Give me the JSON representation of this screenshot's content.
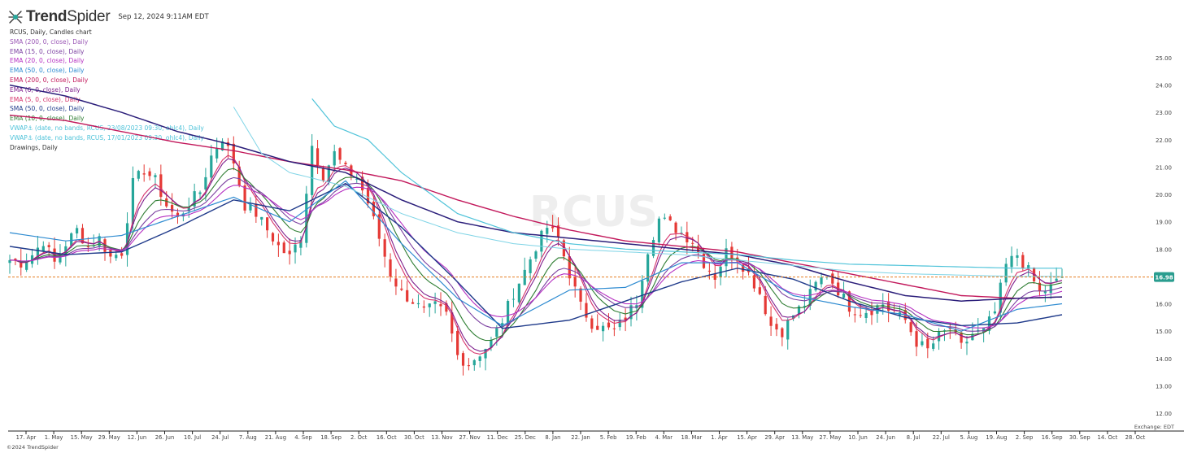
{
  "header": {
    "brand_name": "TrendSpider",
    "datetime": "Sep 12, 2024 9:11AM EDT"
  },
  "chart_info": {
    "title": "RCUS, Daily, Candles chart",
    "indicators": [
      {
        "label": "SMA (200, 0, close), Daily",
        "color": "#9b59b6"
      },
      {
        "label": "EMA (15, 0, close), Daily",
        "color": "#7b3fa0"
      },
      {
        "label": "EMA (20, 0, close), Daily",
        "color": "#b52fc1"
      },
      {
        "label": "EMA (50, 0, close), Daily",
        "color": "#2e8bd1"
      },
      {
        "label": "EMA (200, 0, close), Daily",
        "color": "#c2185b"
      },
      {
        "label": "EMA (6, 0, close), Daily",
        "color": "#7e1e8c"
      },
      {
        "label": "EMA (5, 0, close), Daily",
        "color": "#d6336c"
      },
      {
        "label": "SMA (50, 0, close), Daily",
        "color": "#1f3a8a"
      },
      {
        "label": "EMA (10, 0, close), Daily",
        "color": "#2e7d32"
      },
      {
        "label": "VWAP⚓ (date, no bands, RCUS, 23/08/2023 09:30, ohlc4), Daily",
        "color": "#4fc3d9"
      },
      {
        "label": "VWAP⚓ (date, no bands, RCUS, 17/01/2023 09:30, ohlc4), Daily",
        "color": "#4fc3d9"
      },
      {
        "label": "Drawings, Daily",
        "color": "#333333"
      }
    ]
  },
  "footer": {
    "copyright": "©2024 TrendSpider",
    "exchange": "Exchange: EDT"
  },
  "chart_data": {
    "type": "candlestick",
    "symbol": "RCUS",
    "watermark": "RCUS",
    "timeframe": "Daily",
    "ylim": [
      12.0,
      25.0
    ],
    "y_ticks": [
      12.0,
      13.0,
      14.0,
      15.0,
      16.0,
      17.0,
      18.0,
      19.0,
      20.0,
      21.0,
      22.0,
      23.0,
      24.0,
      25.0
    ],
    "x_ticks": [
      "17. Apr",
      "1. May",
      "15. May",
      "29. May",
      "12. Jun",
      "26. Jun",
      "10. Jul",
      "24. Jul",
      "7. Aug",
      "21. Aug",
      "4. Sep",
      "18. Sep",
      "2. Oct",
      "16. Oct",
      "30. Oct",
      "13. Nov",
      "27. Nov",
      "11. Dec",
      "25. Dec",
      "8. Jan",
      "22. Jan",
      "5. Feb",
      "19. Feb",
      "4. Mar",
      "18. Mar",
      "1. Apr",
      "15. Apr",
      "29. Apr",
      "13. May",
      "27. May",
      "10. Jun",
      "24. Jun",
      "8. Jul",
      "22. Jul",
      "5. Aug",
      "19. Aug",
      "2. Sep",
      "16. Sep",
      "30. Sep",
      "14. Oct",
      "28. Oct"
    ],
    "current_price": 16.98,
    "current_price_label": "16.98",
    "price_line_color": "#e67e22",
    "price_label_color": "#2a9d8f",
    "up_color": "#26a69a",
    "down_color": "#e53935",
    "close_path": [
      [
        0,
        17.6
      ],
      [
        2,
        17.5
      ],
      [
        4,
        17.8
      ],
      [
        6,
        18.3
      ],
      [
        8,
        17.5
      ],
      [
        10,
        18.2
      ],
      [
        12,
        18.7
      ],
      [
        14,
        18.1
      ],
      [
        16,
        18.4
      ],
      [
        18,
        17.7
      ],
      [
        20,
        17.9
      ],
      [
        22,
        20.4
      ],
      [
        24,
        20.9
      ],
      [
        26,
        20.5
      ],
      [
        28,
        19.6
      ],
      [
        30,
        19.1
      ],
      [
        32,
        19.7
      ],
      [
        34,
        20.1
      ],
      [
        36,
        21.4
      ],
      [
        38,
        22.1
      ],
      [
        40,
        21.2
      ],
      [
        42,
        19.6
      ],
      [
        44,
        19.3
      ],
      [
        46,
        18.7
      ],
      [
        48,
        18.1
      ],
      [
        50,
        17.7
      ],
      [
        52,
        18.5
      ],
      [
        54,
        21.8
      ],
      [
        56,
        20.7
      ],
      [
        58,
        21.5
      ],
      [
        60,
        20.9
      ],
      [
        62,
        20.6
      ],
      [
        64,
        19.7
      ],
      [
        66,
        18.4
      ],
      [
        68,
        17.1
      ],
      [
        70,
        16.4
      ],
      [
        72,
        16.1
      ],
      [
        74,
        15.7
      ],
      [
        76,
        15.9
      ],
      [
        78,
        15.6
      ],
      [
        80,
        14.1
      ],
      [
        82,
        13.8
      ],
      [
        84,
        14.2
      ],
      [
        86,
        14.6
      ],
      [
        88,
        15.4
      ],
      [
        90,
        16.4
      ],
      [
        92,
        17.2
      ],
      [
        94,
        18.1
      ],
      [
        96,
        18.8
      ],
      [
        98,
        18.4
      ],
      [
        100,
        17.1
      ],
      [
        102,
        15.9
      ],
      [
        104,
        15.3
      ],
      [
        106,
        15.1
      ],
      [
        108,
        15.0
      ],
      [
        110,
        15.5
      ],
      [
        112,
        16.1
      ],
      [
        114,
        18.0
      ],
      [
        116,
        19.1
      ],
      [
        118,
        18.9
      ],
      [
        120,
        18.6
      ],
      [
        122,
        18.3
      ],
      [
        124,
        17.5
      ],
      [
        126,
        17.0
      ],
      [
        128,
        17.9
      ],
      [
        130,
        17.7
      ],
      [
        132,
        17.1
      ],
      [
        134,
        16.4
      ],
      [
        136,
        15.2
      ],
      [
        138,
        15.0
      ],
      [
        140,
        15.6
      ],
      [
        142,
        16.0
      ],
      [
        144,
        16.7
      ],
      [
        146,
        17.1
      ],
      [
        148,
        16.5
      ],
      [
        150,
        15.9
      ],
      [
        152,
        15.7
      ],
      [
        154,
        15.8
      ],
      [
        156,
        16.0
      ],
      [
        158,
        15.6
      ],
      [
        160,
        15.4
      ],
      [
        162,
        14.6
      ],
      [
        164,
        14.3
      ],
      [
        166,
        14.8
      ],
      [
        168,
        15.1
      ],
      [
        170,
        14.4
      ],
      [
        172,
        14.9
      ],
      [
        174,
        15.0
      ],
      [
        176,
        15.7
      ],
      [
        178,
        17.4
      ],
      [
        180,
        17.8
      ],
      [
        182,
        17.2
      ],
      [
        184,
        16.4
      ],
      [
        186,
        16.6
      ],
      [
        188,
        16.98
      ]
    ],
    "ma_lines": [
      {
        "name": "EMA (200, 0, close), Daily",
        "color": "#c2185b",
        "width": 1.4,
        "points": [
          [
            0,
            22.9
          ],
          [
            10,
            22.7
          ],
          [
            20,
            22.3
          ],
          [
            30,
            21.9
          ],
          [
            40,
            21.6
          ],
          [
            50,
            21.2
          ],
          [
            60,
            20.9
          ],
          [
            70,
            20.5
          ],
          [
            80,
            19.8
          ],
          [
            90,
            19.2
          ],
          [
            100,
            18.7
          ],
          [
            110,
            18.3
          ],
          [
            120,
            18.1
          ],
          [
            130,
            17.9
          ],
          [
            140,
            17.5
          ],
          [
            150,
            17.1
          ],
          [
            160,
            16.7
          ],
          [
            170,
            16.3
          ],
          [
            180,
            16.2
          ],
          [
            188,
            16.25
          ]
        ]
      },
      {
        "name": "SMA (200, 0, close), Daily",
        "color": "#2b1e7a",
        "width": 1.5,
        "points": [
          [
            0,
            24.0
          ],
          [
            10,
            23.6
          ],
          [
            20,
            23.0
          ],
          [
            30,
            22.3
          ],
          [
            40,
            21.8
          ],
          [
            50,
            21.2
          ],
          [
            60,
            20.8
          ],
          [
            70,
            19.8
          ],
          [
            80,
            19.0
          ],
          [
            90,
            18.6
          ],
          [
            100,
            18.4
          ],
          [
            110,
            18.2
          ],
          [
            120,
            18.0
          ],
          [
            130,
            17.8
          ],
          [
            140,
            17.4
          ],
          [
            150,
            16.8
          ],
          [
            160,
            16.3
          ],
          [
            170,
            16.1
          ],
          [
            180,
            16.2
          ],
          [
            188,
            16.25
          ]
        ]
      },
      {
        "name": "SMA (50, 0, close), Daily",
        "color": "#1f3a8a",
        "width": 1.4,
        "points": [
          [
            0,
            18.1
          ],
          [
            10,
            17.8
          ],
          [
            20,
            17.9
          ],
          [
            30,
            18.8
          ],
          [
            40,
            19.8
          ],
          [
            50,
            19.4
          ],
          [
            60,
            20.4
          ],
          [
            70,
            18.8
          ],
          [
            80,
            16.8
          ],
          [
            88,
            15.1
          ],
          [
            100,
            15.4
          ],
          [
            110,
            16.1
          ],
          [
            120,
            16.8
          ],
          [
            130,
            17.3
          ],
          [
            140,
            16.9
          ],
          [
            150,
            16.1
          ],
          [
            160,
            15.5
          ],
          [
            170,
            15.2
          ],
          [
            180,
            15.3
          ],
          [
            188,
            15.6
          ]
        ]
      },
      {
        "name": "EMA (50, 0, close), Daily",
        "color": "#2e8bd1",
        "width": 1.2,
        "points": [
          [
            0,
            18.6
          ],
          [
            10,
            18.3
          ],
          [
            20,
            18.5
          ],
          [
            30,
            19.2
          ],
          [
            40,
            19.9
          ],
          [
            50,
            19.0
          ],
          [
            60,
            20.5
          ],
          [
            70,
            18.2
          ],
          [
            80,
            16.2
          ],
          [
            88,
            15.2
          ],
          [
            100,
            16.5
          ],
          [
            110,
            16.6
          ],
          [
            120,
            17.5
          ],
          [
            130,
            17.5
          ],
          [
            140,
            16.3
          ],
          [
            150,
            15.9
          ],
          [
            160,
            15.6
          ],
          [
            170,
            15.0
          ],
          [
            180,
            15.8
          ],
          [
            188,
            16.0
          ]
        ]
      },
      {
        "name": "VWAP⚓ (date, no bands, RCUS, 23/08/2023 09:30, ohlc4), Daily",
        "color": "#4fc3d9",
        "width": 1.2,
        "points": [
          [
            54,
            23.5
          ],
          [
            58,
            22.5
          ],
          [
            64,
            22.0
          ],
          [
            70,
            20.8
          ],
          [
            80,
            19.3
          ],
          [
            90,
            18.6
          ],
          [
            100,
            18.2
          ],
          [
            110,
            18.0
          ],
          [
            120,
            17.9
          ],
          [
            130,
            17.8
          ],
          [
            140,
            17.6
          ],
          [
            150,
            17.45
          ],
          [
            160,
            17.4
          ],
          [
            170,
            17.35
          ],
          [
            180,
            17.3
          ],
          [
            188,
            17.3
          ]
        ]
      },
      {
        "name": "VWAP⚓ (date, no bands, RCUS, 17/01/2023 09:30, ohlc4), Daily",
        "color": "#7fd4e6",
        "width": 1.0,
        "points": [
          [
            40,
            23.2
          ],
          [
            45,
            21.5
          ],
          [
            50,
            20.8
          ],
          [
            60,
            20.3
          ],
          [
            70,
            19.3
          ],
          [
            80,
            18.6
          ],
          [
            90,
            18.2
          ],
          [
            100,
            18.0
          ],
          [
            110,
            17.9
          ],
          [
            120,
            17.8
          ],
          [
            130,
            17.6
          ],
          [
            140,
            17.4
          ],
          [
            150,
            17.2
          ],
          [
            160,
            17.1
          ],
          [
            170,
            17.05
          ],
          [
            180,
            17.0
          ],
          [
            188,
            17.0
          ]
        ]
      }
    ],
    "fast_ma_names": [
      "EMA (5, 0, close), Daily",
      "EMA (6, 0, close), Daily",
      "EMA (10, 0, close), Daily",
      "EMA (15, 0, close), Daily",
      "EMA (20, 0, close), Daily"
    ],
    "fast_ma_colors": [
      "#d6336c",
      "#7e1e8c",
      "#2e7d32",
      "#7b3fa0",
      "#b52fc1"
    ]
  }
}
